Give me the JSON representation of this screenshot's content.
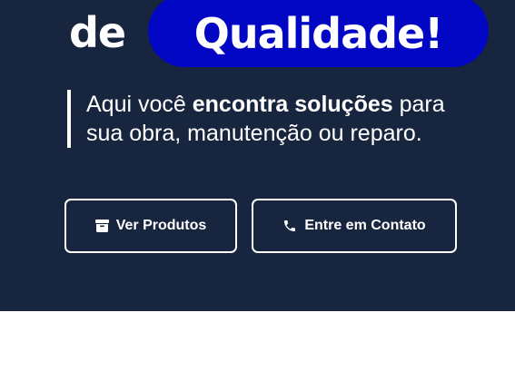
{
  "hero": {
    "headline_prefix": "de",
    "headline_highlight": "Qualidade!",
    "subtitle_part1": "Aqui você ",
    "subtitle_bold": "encontra soluções",
    "subtitle_part2": " para",
    "subtitle_line2": "sua obra, manutenção ou reparo.",
    "background_color": "#17253e",
    "highlight_color": "#0207c4"
  },
  "buttons": {
    "products": {
      "label": "Ver Produtos",
      "icon": "box-icon"
    },
    "contact": {
      "label": "Entre em Contato",
      "icon": "phone-icon"
    }
  }
}
